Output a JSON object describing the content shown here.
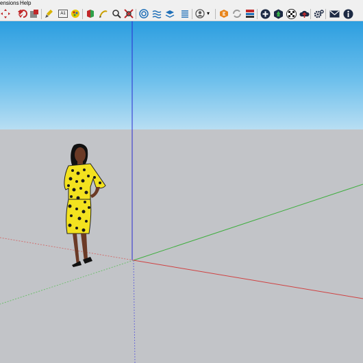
{
  "menu": {
    "extensions_label": "ensions",
    "help_label": "Help"
  },
  "toolbar": {
    "tools": [
      {
        "name": "move-icon"
      },
      {
        "name": "rotate-icon"
      },
      {
        "name": "scale-icon"
      },
      {
        "name": "paint-bucket-icon"
      },
      {
        "name": "text-icon"
      },
      {
        "name": "materials-icon"
      },
      {
        "name": "section-plane-icon"
      },
      {
        "name": "orbit-icon"
      },
      {
        "name": "zoom-icon"
      },
      {
        "name": "zoom-extents-icon"
      },
      {
        "name": "sandbox-icon"
      },
      {
        "name": "water-icon"
      },
      {
        "name": "layers-icon"
      },
      {
        "name": "shadows-icon"
      },
      {
        "name": "user-account-icon"
      },
      {
        "name": "extension-warehouse-icon"
      },
      {
        "name": "sync-icon"
      },
      {
        "name": "layout-icon"
      },
      {
        "name": "add-icon"
      },
      {
        "name": "trimble-connect-icon"
      },
      {
        "name": "checker-icon"
      },
      {
        "name": "cloud-upload-icon"
      },
      {
        "name": "settings-icon"
      },
      {
        "name": "mail-icon"
      },
      {
        "name": "info-icon"
      }
    ],
    "text_tool_label": "A1"
  },
  "scene": {
    "sky_color": "#2c9ee0",
    "ground_color": "#c2c4c8",
    "axis_colors": {
      "red": "#d04040",
      "green": "#3fae3f",
      "blue": "#2a2ad0"
    },
    "dress_color": "#f3e21f",
    "skin_color": "#6b3a26"
  }
}
